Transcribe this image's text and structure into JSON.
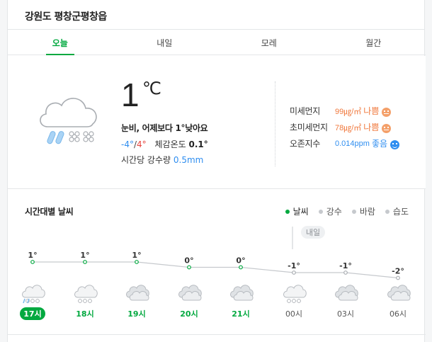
{
  "header": {
    "location": "강원도 평창군평창읍"
  },
  "tabs": [
    {
      "label": "오늘",
      "active": true
    },
    {
      "label": "내일",
      "active": false
    },
    {
      "label": "모레",
      "active": false
    },
    {
      "label": "월간",
      "active": false
    }
  ],
  "current": {
    "icon": "snow-rain-icon",
    "temperature": "1",
    "unit": "℃",
    "summary": "눈비, 어제보다 1°낮아요",
    "min": "-4°",
    "max": "4°",
    "feels_label": "체감온도",
    "feels": "0.1°",
    "precip_label": "시간당 강수량",
    "precip": "0.5mm"
  },
  "air": [
    {
      "label": "미세먼지",
      "value": "99㎍/㎥",
      "status": "나쁨",
      "level": "bad"
    },
    {
      "label": "초미세먼지",
      "value": "78㎍/㎥",
      "status": "나쁨",
      "level": "bad"
    },
    {
      "label": "오존지수",
      "value": "0.014ppm",
      "status": "좋음",
      "level": "good"
    }
  ],
  "hourly": {
    "title": "시간대별 날씨",
    "filters": [
      {
        "label": "날씨",
        "active": true
      },
      {
        "label": "강수",
        "active": false
      },
      {
        "label": "바람",
        "active": false
      },
      {
        "label": "습도",
        "active": false
      }
    ],
    "tomorrow_label": "내일",
    "items": [
      {
        "hour": "17시",
        "temp": 1,
        "temp_label": "1°",
        "icon": "snow-rain-icon",
        "current": true,
        "today": true
      },
      {
        "hour": "18시",
        "temp": 1,
        "temp_label": "1°",
        "icon": "snow-icon",
        "current": false,
        "today": true
      },
      {
        "hour": "19시",
        "temp": 1,
        "temp_label": "1°",
        "icon": "cloudy-icon",
        "current": false,
        "today": true
      },
      {
        "hour": "20시",
        "temp": 0,
        "temp_label": "0°",
        "icon": "cloudy-icon",
        "current": false,
        "today": true
      },
      {
        "hour": "21시",
        "temp": 0,
        "temp_label": "0°",
        "icon": "cloudy-icon",
        "current": false,
        "today": true
      },
      {
        "hour": "00시",
        "temp": -1,
        "temp_label": "-1°",
        "icon": "snow-icon",
        "current": false,
        "today": false
      },
      {
        "hour": "03시",
        "temp": -1,
        "temp_label": "-1°",
        "icon": "cloudy-icon",
        "current": false,
        "today": false
      },
      {
        "hour": "06시",
        "temp": -2,
        "temp_label": "-2°",
        "icon": "cloudy-icon",
        "current": false,
        "today": false
      }
    ]
  },
  "colors": {
    "accent": "#03a940",
    "bad": "#f0783c",
    "good": "#2f8ef0",
    "cold": "#2f8ef0",
    "hot": "#e7453e"
  }
}
